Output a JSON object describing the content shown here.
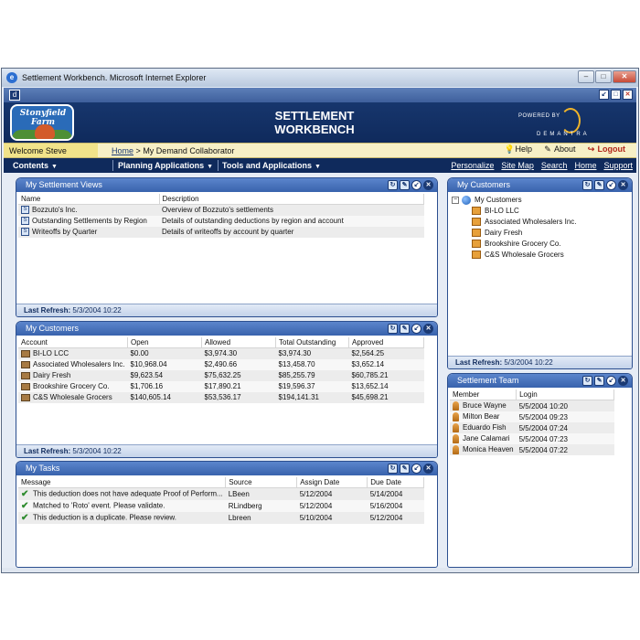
{
  "window": {
    "title": "Settlement Workbench. Microsoft Internet Explorer"
  },
  "banner": {
    "logo_text": "Stonyfield Farm",
    "title": "SETTLEMENT WORKBENCH",
    "powered_by": "POWERED BY",
    "brand": "DEMANTRA"
  },
  "welcome": {
    "greeting": "Welcome Steve",
    "home": "Home",
    "separator": ">",
    "current": "My Demand Collaborator",
    "help": "Help",
    "about": "About",
    "logout": "Logout"
  },
  "nav": {
    "menus": [
      "Contents",
      "Planning Applications",
      "Tools and Applications"
    ],
    "links": [
      "Personalize",
      "Site Map",
      "Search",
      "Home",
      "Support"
    ]
  },
  "settlement_views": {
    "title": "My Settlement Views",
    "columns": [
      "Name",
      "Description"
    ],
    "rows": [
      [
        "Bozzuto's Inc.",
        "Overview of Bozzuto's settlements"
      ],
      [
        "Outstanding Settlements by Region",
        "Details of outstanding deductions by region and account"
      ],
      [
        "Writeoffs by Quarter",
        "Details of writeoffs by account by quarter"
      ]
    ],
    "footer_label": "Last Refresh:",
    "footer_value": "5/3/2004 10:22"
  },
  "customers_table": {
    "title": "My Customers",
    "columns": [
      "Account",
      "Open",
      "Allowed",
      "Total Outstanding",
      "Approved"
    ],
    "rows": [
      [
        "BI-LO LCC",
        "$0.00",
        "$3,974.30",
        "$3,974.30",
        "$2,564.25"
      ],
      [
        "Associated Wholesalers Inc.",
        "$10,968.04",
        "$2,490.66",
        "$13,458.70",
        "$3,652.14"
      ],
      [
        "Dairy Fresh",
        "$9,623.54",
        "$75,632.25",
        "$85,255.79",
        "$60,785.21"
      ],
      [
        "Brookshire Grocery Co.",
        "$1,706.16",
        "$17,890.21",
        "$19,596.37",
        "$13,652.14"
      ],
      [
        "C&S Wholesale Grocers",
        "$140,605.14",
        "$53,536.17",
        "$194,141.31",
        "$45,698.21"
      ]
    ],
    "footer_label": "Last Refresh:",
    "footer_value": "5/3/2004 10:22"
  },
  "tasks": {
    "title": "My Tasks",
    "columns": [
      "Message",
      "Source",
      "Assign Date",
      "Due Date"
    ],
    "rows": [
      [
        "This deduction does not have adequate Proof of Perform...",
        "LBeen",
        "5/12/2004",
        "5/14/2004"
      ],
      [
        "Matched to 'Roto' event. Please validate.",
        "RLindberg",
        "5/12/2004",
        "5/16/2004"
      ],
      [
        "This deduction is a duplicate. Please review.",
        "Lbreen",
        "5/10/2004",
        "5/12/2004"
      ]
    ]
  },
  "customers_tree": {
    "title": "My Customers",
    "root": "My Customers",
    "toggle": "−",
    "children": [
      "BI-LO LLC",
      "Associated Wholesalers Inc.",
      "Dairy Fresh",
      "Brookshire Grocery Co.",
      "C&S Wholesale Grocers"
    ],
    "footer_label": "Last Refresh:",
    "footer_value": "5/3/2004 10:22"
  },
  "team": {
    "title": "Settlement Team",
    "columns": [
      "Member",
      "Login"
    ],
    "rows": [
      [
        "Bruce Wayne",
        "5/5/2004 10:20"
      ],
      [
        "Milton Bear",
        "5/5/2004 09:23"
      ],
      [
        "Eduardo Fish",
        "5/5/2004 07:24"
      ],
      [
        "Jane Calamari",
        "5/5/2004 07:23"
      ],
      [
        "Monica Heaven",
        "5/5/2004 07:22"
      ]
    ]
  },
  "colors": {
    "banner": "#0f2a5c",
    "portlet_header": "#3963ad",
    "welcome_bar": "#f7f0c6",
    "logout": "#b2261a"
  }
}
